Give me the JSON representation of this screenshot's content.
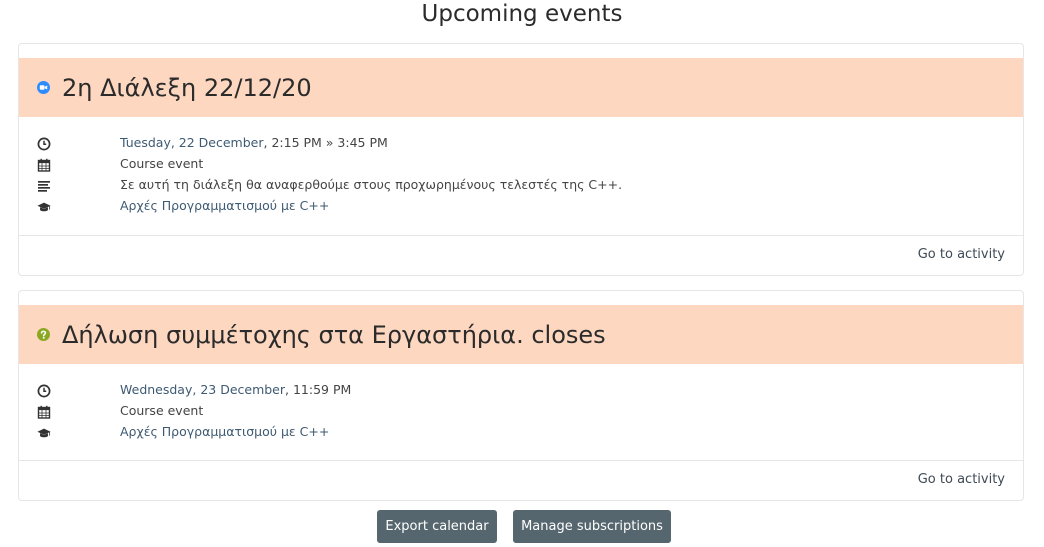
{
  "page": {
    "title": "Upcoming events"
  },
  "events": [
    {
      "name": "2η Διάλεξη 22/12/20",
      "type_icon": "video-meeting-icon",
      "date_day": "Tuesday, 22 December",
      "time_range": ", 2:15 PM » 3:45 PM",
      "event_type": "Course event",
      "description": "Σε αυτή τη διάλεξη θα αναφερθούμε στους προχωρημένους τελεστές της C++.",
      "course": "Αρχές Προγραμματισμού με C++",
      "action_label": "Go to activity"
    },
    {
      "name": "Δήλωση συμμέτοχης στα Εργαστήρια. closes",
      "type_icon": "choice-question-icon",
      "date_day": "Wednesday, 23 December",
      "time_range": ", 11:59 PM",
      "event_type": "Course event",
      "course": "Αρχές Προγραμματισμού με C++",
      "action_label": "Go to activity"
    }
  ],
  "footer": {
    "export_label": "Export calendar",
    "manage_label": "Manage subscriptions"
  },
  "colors": {
    "header_bg": "#fdd7bf",
    "button_bg": "#56666f",
    "video_icon": "#2d8cff",
    "question_icon": "#8aa823"
  }
}
